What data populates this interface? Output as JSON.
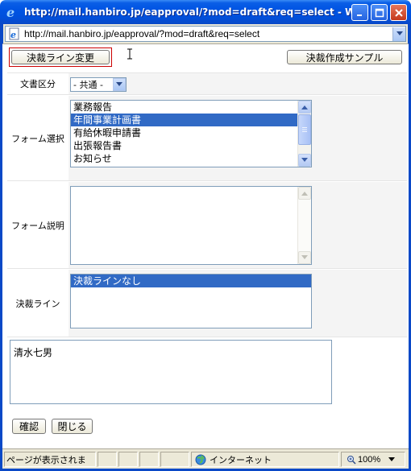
{
  "window": {
    "title": "http://mail.hanbiro.jp/eapproval/?mod=draft&req=select - W...",
    "url": "http://mail.hanbiro.jp/eapproval/?mod=draft&req=select"
  },
  "toolbar": {
    "change_approval_line_label": "決裁ライン変更",
    "sample_label": "決裁作成サンプル"
  },
  "form": {
    "doc_category": {
      "label": "文書区分",
      "selected": "- 共通 -"
    },
    "form_select": {
      "label": "フォーム選択",
      "options": [
        "業務報告",
        "年間事業計画書",
        "有給休暇申請書",
        "出張報告書",
        "お知らせ"
      ],
      "selected_index": 1
    },
    "form_description": {
      "label": "フォーム説明",
      "value": ""
    },
    "approval_line": {
      "label": "決裁ライン",
      "options": [
        "決裁ラインなし"
      ],
      "selected_index": 0
    }
  },
  "approvers_box": {
    "value": "清水七男"
  },
  "buttons": {
    "confirm_label": "確認",
    "close_label": "閉じる"
  },
  "statusbar": {
    "status_text": "ページが表示されま",
    "zone_text": "インターネット",
    "zoom_text": "100%"
  },
  "colors": {
    "title_bar": "#0054e3",
    "selection": "#316ac5",
    "focus_ring": "#cc0000"
  }
}
